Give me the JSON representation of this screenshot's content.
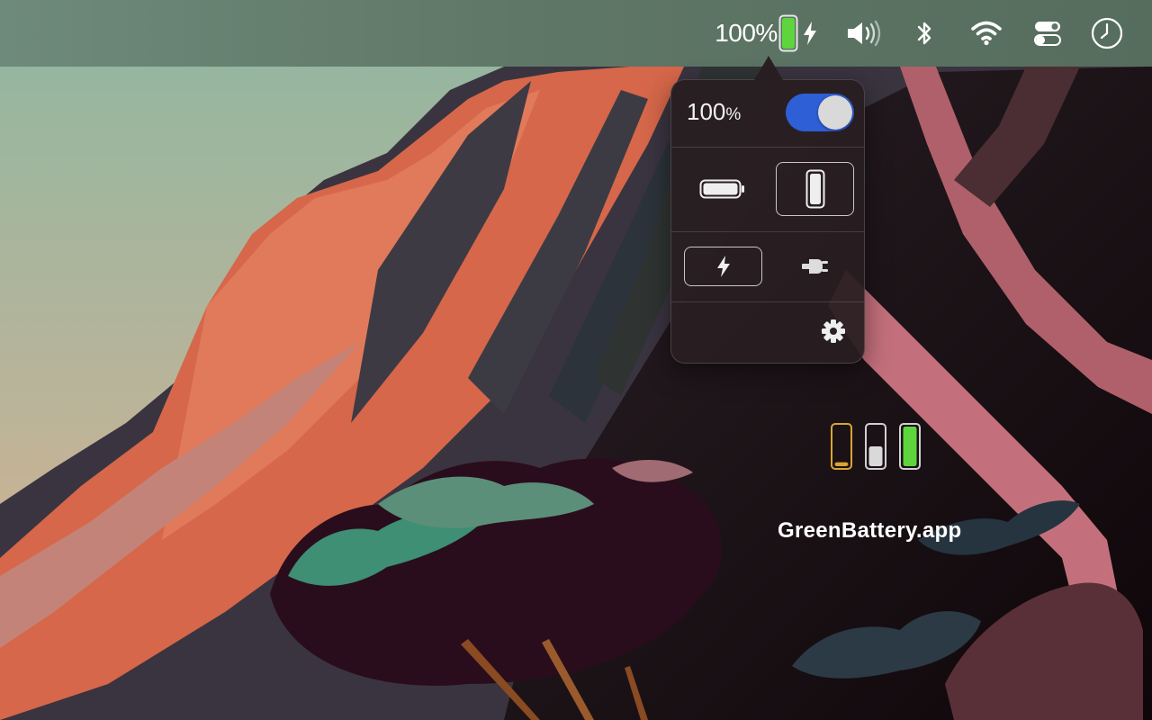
{
  "menubar": {
    "battery_percent": "100",
    "percent_sign": "%",
    "battery_level": 1.0,
    "charging": true,
    "status_icons": [
      "battery-icon",
      "lightning-icon",
      "volume-icon",
      "bluetooth-icon",
      "wifi-icon",
      "control-center-icon",
      "clock-icon"
    ]
  },
  "popover": {
    "percent_value": "100",
    "percent_sign": "%",
    "show_percentage_toggle": true,
    "orientation_options": [
      "horizontal-battery-icon",
      "vertical-battery-icon"
    ],
    "orientation_selected": "vertical",
    "indicator_options": [
      "lightning-icon",
      "plug-icon"
    ],
    "indicator_selected": "lightning",
    "settings_icon": "gear-icon"
  },
  "illustration": {
    "mini_batteries": [
      {
        "level": 0.1,
        "color": "#d9a531"
      },
      {
        "level": 0.5,
        "color": "#d9d9d9"
      },
      {
        "level": 1.0,
        "color": "#5ed43d"
      }
    ]
  },
  "caption": "GreenBattery.app",
  "colors": {
    "battery_green": "#5ed43d",
    "toggle_blue": "#2f5fd6",
    "menubar": "#5f7767"
  }
}
